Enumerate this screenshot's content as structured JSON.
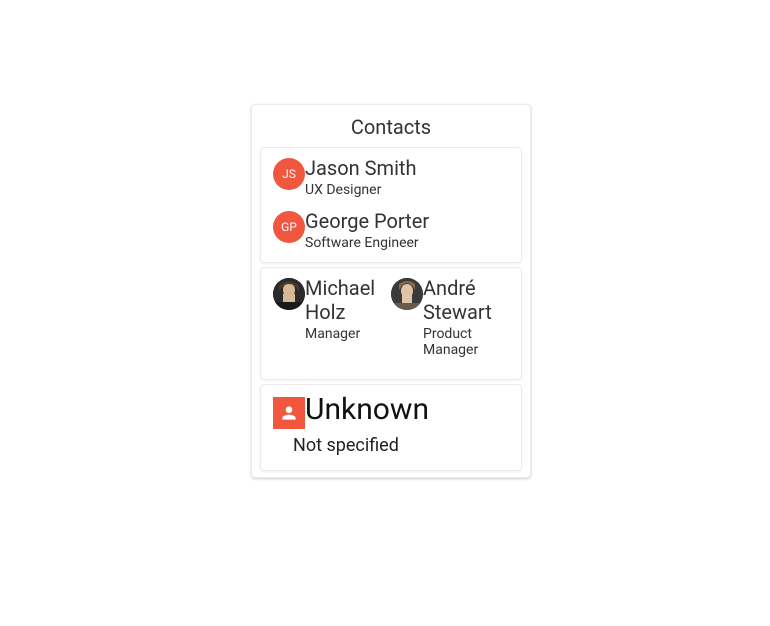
{
  "panel": {
    "title": "Contacts"
  },
  "groups": [
    {
      "entries": [
        {
          "initials": "JS",
          "name": "Jason Smith",
          "role": "UX Designer"
        },
        {
          "initials": "GP",
          "name": "George Porter",
          "role": "Software Engineer"
        }
      ]
    },
    {
      "entries": [
        {
          "photo": "man1",
          "name": "Michael Holz",
          "role": "Manager"
        },
        {
          "photo": "man2",
          "name": "André Stewart",
          "role": "Product Manager"
        }
      ]
    },
    {
      "entries": [
        {
          "unknown": true,
          "name": "Unknown",
          "role": "Not specified"
        }
      ]
    }
  ],
  "colors": {
    "accent": "#f1573f"
  }
}
